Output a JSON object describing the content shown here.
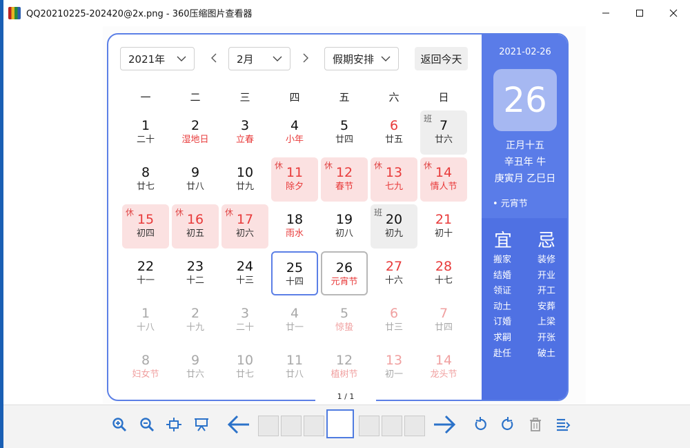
{
  "window": {
    "title": "QQ20210225-202420@2x.png - 360压缩图片查看器",
    "controls": {
      "minimize": "—",
      "maximize": "☐",
      "close": "✕"
    }
  },
  "calendar": {
    "year_select": "2021年",
    "month_select": "2月",
    "holiday_select": "假期安排",
    "today_button": "返回今天",
    "weekdays": [
      "一",
      "二",
      "三",
      "四",
      "五",
      "六",
      "日"
    ],
    "rows": [
      [
        {
          "num": "1",
          "sub": "二十"
        },
        {
          "num": "2",
          "sub": "湿地日",
          "style": "redsub"
        },
        {
          "num": "3",
          "sub": "立春",
          "style": "redsub"
        },
        {
          "num": "4",
          "sub": "小年",
          "style": "redsub"
        },
        {
          "num": "5",
          "sub": "廿四"
        },
        {
          "num": "6",
          "sub": "廿五",
          "style": "red"
        },
        {
          "num": "7",
          "sub": "廿六",
          "tag": "班",
          "style": "work"
        }
      ],
      [
        {
          "num": "8",
          "sub": "廿七"
        },
        {
          "num": "9",
          "sub": "廿八"
        },
        {
          "num": "10",
          "sub": "廿九"
        },
        {
          "num": "11",
          "sub": "除夕",
          "tag": "休",
          "style": "holiday red redsub"
        },
        {
          "num": "12",
          "sub": "春节",
          "tag": "休",
          "style": "holiday red redsub"
        },
        {
          "num": "13",
          "sub": "七九",
          "tag": "休",
          "style": "holiday red redsub"
        },
        {
          "num": "14",
          "sub": "情人节",
          "tag": "休",
          "style": "holiday red redsub"
        }
      ],
      [
        {
          "num": "15",
          "sub": "初四",
          "tag": "休",
          "style": "holiday red"
        },
        {
          "num": "16",
          "sub": "初五",
          "tag": "休",
          "style": "holiday red"
        },
        {
          "num": "17",
          "sub": "初六",
          "tag": "休",
          "style": "holiday red"
        },
        {
          "num": "18",
          "sub": "雨水",
          "style": "redsub"
        },
        {
          "num": "19",
          "sub": "初八"
        },
        {
          "num": "20",
          "sub": "初九",
          "tag": "班",
          "style": "work"
        },
        {
          "num": "21",
          "sub": "初十",
          "style": "red"
        }
      ],
      [
        {
          "num": "22",
          "sub": "十一"
        },
        {
          "num": "23",
          "sub": "十二"
        },
        {
          "num": "24",
          "sub": "十三"
        },
        {
          "num": "25",
          "sub": "十四",
          "style": "selected"
        },
        {
          "num": "26",
          "sub": "元宵节",
          "style": "today redsub"
        },
        {
          "num": "27",
          "sub": "十六",
          "style": "red"
        },
        {
          "num": "28",
          "sub": "十七",
          "style": "red"
        }
      ],
      [
        {
          "num": "1",
          "sub": "十八",
          "style": "other"
        },
        {
          "num": "2",
          "sub": "十九",
          "style": "other"
        },
        {
          "num": "3",
          "sub": "二十",
          "style": "other"
        },
        {
          "num": "4",
          "sub": "廿一",
          "style": "other"
        },
        {
          "num": "5",
          "sub": "惊蛰",
          "style": "other redsub"
        },
        {
          "num": "6",
          "sub": "廿三",
          "style": "other red"
        },
        {
          "num": "7",
          "sub": "廿四",
          "style": "other red"
        }
      ],
      [
        {
          "num": "8",
          "sub": "妇女节",
          "style": "other redsub"
        },
        {
          "num": "9",
          "sub": "廿六",
          "style": "other"
        },
        {
          "num": "10",
          "sub": "廿七",
          "style": "other"
        },
        {
          "num": "11",
          "sub": "廿八",
          "style": "other"
        },
        {
          "num": "12",
          "sub": "植树节",
          "style": "other redsub"
        },
        {
          "num": "13",
          "sub": "初一",
          "style": "other red"
        },
        {
          "num": "14",
          "sub": "龙头节",
          "style": "other red redsub"
        }
      ]
    ]
  },
  "day_panel": {
    "date": "2021-02-26",
    "day": "26",
    "lunar_lines": [
      "正月十五",
      "辛丑年 牛",
      "庚寅月 乙巳日"
    ],
    "festival": "• 元宵节",
    "yi_title": "宜",
    "ji_title": "忌",
    "yi": [
      "搬家",
      "结婚",
      "领证",
      "动土",
      "订婚",
      "求嗣",
      "赴任"
    ],
    "ji": [
      "装修",
      "开业",
      "开工",
      "安葬",
      "上梁",
      "开张",
      "破土"
    ]
  },
  "viewer": {
    "page_indicator": "1 / 1"
  },
  "colors": {
    "accent": "#5a7ce8",
    "holiday_bg": "#fbe1e1",
    "red_text": "#e83a3a",
    "toolbar_icon": "#2b72c9"
  }
}
